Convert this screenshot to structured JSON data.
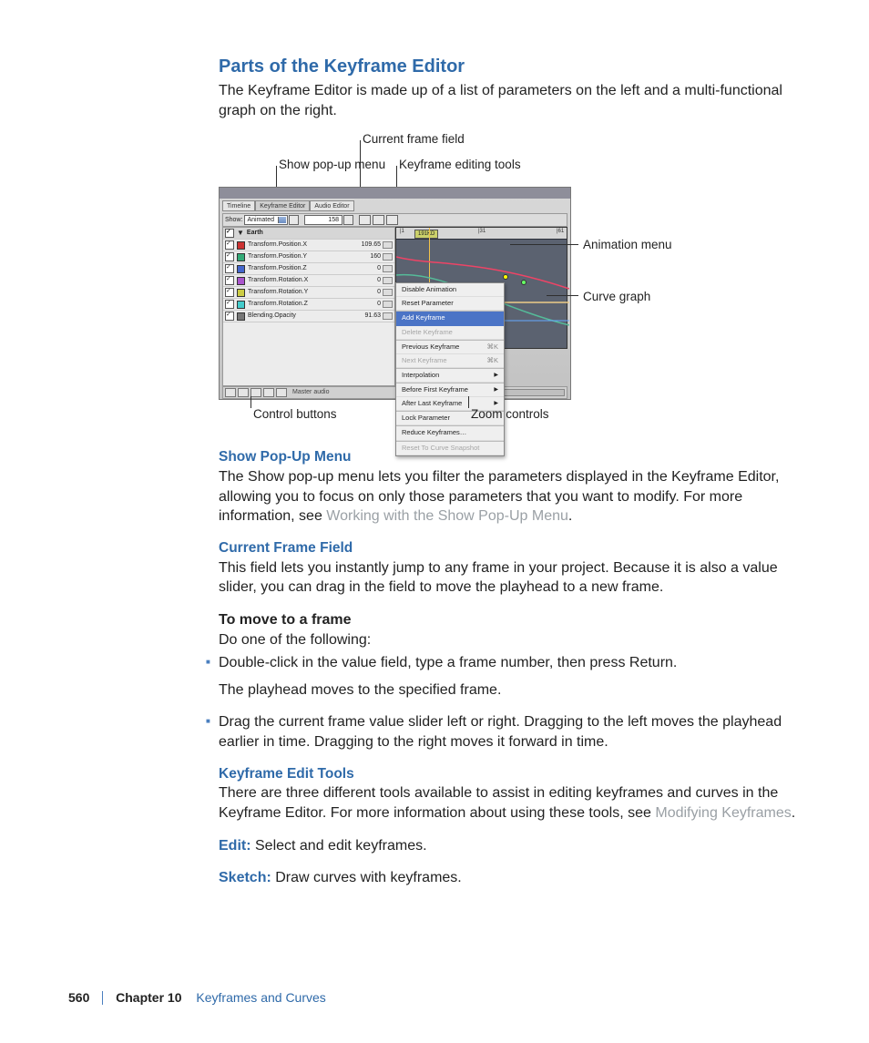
{
  "title": "Parts of the Keyframe Editor",
  "intro": "The Keyframe Editor is made up of a list of parameters on the left and a multi-functional graph on the right.",
  "figure": {
    "callouts": {
      "current_frame_field": "Current frame field",
      "show_popup": "Show pop-up menu",
      "keyframe_tools": "Keyframe editing tools",
      "animation_menu": "Animation menu",
      "curve_graph": "Curve graph",
      "control_buttons": "Control buttons",
      "zoom_controls": "Zoom controls"
    },
    "ui": {
      "tabs": [
        "Timeline",
        "Keyframe Editor",
        "Audio Editor"
      ],
      "show_label": "Show:",
      "show_value": "Animated",
      "frame_value": "158",
      "root_row": "Earth",
      "params": [
        {
          "name": "Transform.Position.X",
          "value": "109.65",
          "color": "#c33"
        },
        {
          "name": "Transform.Position.Y",
          "value": "160",
          "color": "#3a7"
        },
        {
          "name": "Transform.Position.Z",
          "value": "0",
          "color": "#46c"
        },
        {
          "name": "Transform.Rotation.X",
          "value": "0",
          "color": "#a5c"
        },
        {
          "name": "Transform.Rotation.Y",
          "value": "0",
          "color": "#cc4"
        },
        {
          "name": "Transform.Rotation.Z",
          "value": "0",
          "color": "#4cc"
        },
        {
          "name": "Blending.Opacity",
          "value": "91.63",
          "color": "#777"
        }
      ],
      "controls_label": "Master audio",
      "ruler_ticks": [
        "|1",
        "|31",
        "|61"
      ],
      "frame_badge": "191KD"
    },
    "menu": [
      {
        "label": "Disable Animation"
      },
      {
        "label": "Reset Parameter"
      },
      {
        "sep": true
      },
      {
        "label": "Add Keyframe",
        "highlight": true
      },
      {
        "label": "Delete Keyframe",
        "disabled": true
      },
      {
        "sep": true
      },
      {
        "label": "Previous Keyframe",
        "shortcut": "⌘K"
      },
      {
        "label": "Next Keyframe",
        "shortcut": "⌘K",
        "disabled": true
      },
      {
        "sep": true
      },
      {
        "label": "Interpolation",
        "submenu": true
      },
      {
        "sep": true
      },
      {
        "label": "Before First Keyframe",
        "submenu": true
      },
      {
        "label": "After Last Keyframe",
        "submenu": true
      },
      {
        "sep": true
      },
      {
        "label": "Lock Parameter"
      },
      {
        "sep": true
      },
      {
        "label": "Reduce Keyframes…"
      },
      {
        "sep": true
      },
      {
        "label": "Reset To Curve Snapshot",
        "disabled": true
      }
    ]
  },
  "section_show": {
    "heading": "Show Pop-Up Menu",
    "body_a": "The Show pop-up menu lets you filter the parameters displayed in the Keyframe Editor, allowing you to focus on only those parameters that you want to modify. For more information, see ",
    "link": "Working with the Show Pop-Up Menu",
    "body_b": "."
  },
  "section_frame": {
    "heading": "Current Frame Field",
    "body": "This field lets you instantly jump to any frame in your project. Because it is also a value slider, you can drag in the field to move the playhead to a new frame.",
    "task_heading": "To move to a frame",
    "task_intro": "Do one of the following:",
    "steps": [
      {
        "a": "Double-click in the value field, type a frame number, then press Return.",
        "b": "The playhead moves to the specified frame."
      },
      {
        "a": "Drag the current frame value slider left or right. Dragging to the left moves the playhead earlier in time. Dragging to the right moves it forward in time."
      }
    ]
  },
  "section_tools": {
    "heading": "Keyframe Edit Tools",
    "body_a": "There are three different tools available to assist in editing keyframes and curves in the Keyframe Editor. For more information about using these tools, see ",
    "link": "Modifying Keyframes",
    "body_b": "."
  },
  "terms": [
    {
      "term": "Edit:",
      "desc": "  Select and edit keyframes."
    },
    {
      "term": "Sketch:",
      "desc": "  Draw curves with keyframes."
    }
  ],
  "footer": {
    "page": "560",
    "chapter_num": "Chapter 10",
    "chapter_title": "Keyframes and Curves"
  }
}
